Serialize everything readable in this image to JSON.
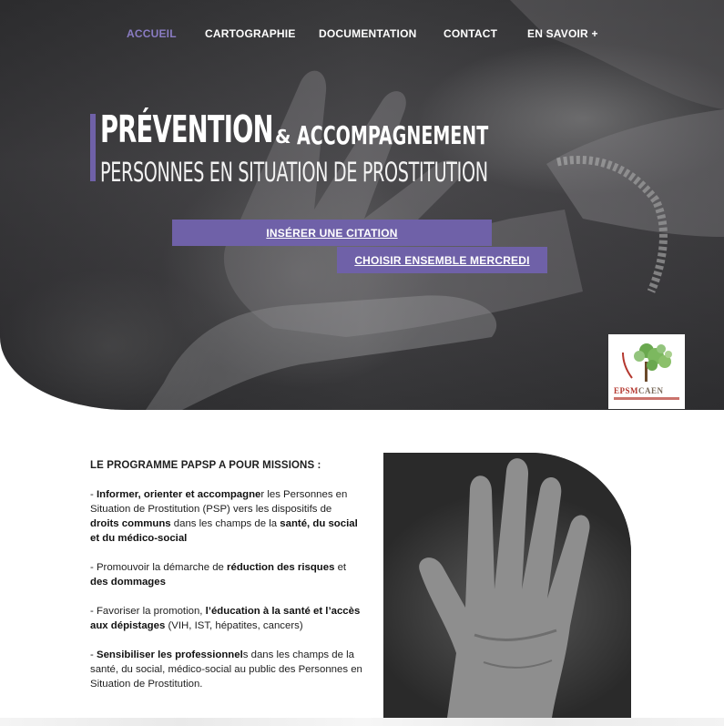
{
  "nav": {
    "items": [
      {
        "label": "ACCUEIL",
        "active": true
      },
      {
        "label": "CARTOGRAPHIE"
      },
      {
        "label": "DOCUMENTATION"
      },
      {
        "label": "CONTACT"
      },
      {
        "label": "EN SAVOIR +"
      }
    ]
  },
  "hero": {
    "title_main": "PRÉVENTION",
    "title_amp": "&",
    "title_secondary": "ACCOMPAGNEMENT",
    "subtitle": "PERSONNES EN SITUATION DE PROSTITUTION",
    "button_quote": "INSÉRER UNE CITATION",
    "button_choose": "CHOISIR ENSEMBLE MERCREDI"
  },
  "logo": {
    "text_a": "EPSM",
    "text_b": "CAEN",
    "icon": "tree-logo-icon"
  },
  "missions": {
    "heading": "LE PROGRAMME PAPSP A POUR MISSIONS :",
    "p1": {
      "s1": " - ",
      "b1": "Informer, orienter et accompagne",
      "s2": "r les Personnes en Situation de Prostitution (PSP) vers les dispositifs de ",
      "b2": "droits communs",
      "s3": " dans les champs de la ",
      "b3": "santé, du social et du médico-social"
    },
    "p2": {
      "s1": "- Promouvoir la démarche de ",
      "b1": "réduction des risques",
      "s2": " et ",
      "b2": "des dommages"
    },
    "p3": {
      "s1": " - Favoriser la promotion, ",
      "b1": "l’éducation à la santé et l’accès aux dépistages",
      "s2": " (VIH, IST, hépatites, cancers)"
    },
    "p4": {
      "s1": "- ",
      "b1": "Sensibiliser les professionnel",
      "s2": "s dans les champs de la santé, du social, médico-social au public des Personnes en Situation de Prostitution."
    }
  },
  "colors": {
    "accent": "#6f61a8",
    "nav_active": "#8a7cc3"
  }
}
